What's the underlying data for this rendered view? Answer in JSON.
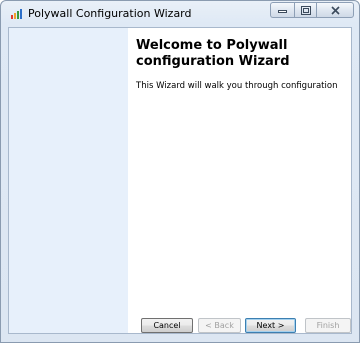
{
  "window": {
    "title": "Polywall Configuration Wizard"
  },
  "page": {
    "title": "Welcome to Polywall configuration Wizard",
    "description": "This Wizard will walk you through configuration"
  },
  "buttons": {
    "cancel": "Cancel",
    "back": "< Back",
    "next": "Next >",
    "finish": "Finish"
  },
  "icons": {
    "app": "polywall-bars-icon",
    "minimize": "minimize-icon",
    "maximize": "maximize-icon",
    "close": "close-icon"
  },
  "colors": {
    "side_panel": "#e7f0fb",
    "icon_bars": [
      "#e03b2e",
      "#f2a12b",
      "#3a9a3c",
      "#2d6fc9"
    ]
  }
}
